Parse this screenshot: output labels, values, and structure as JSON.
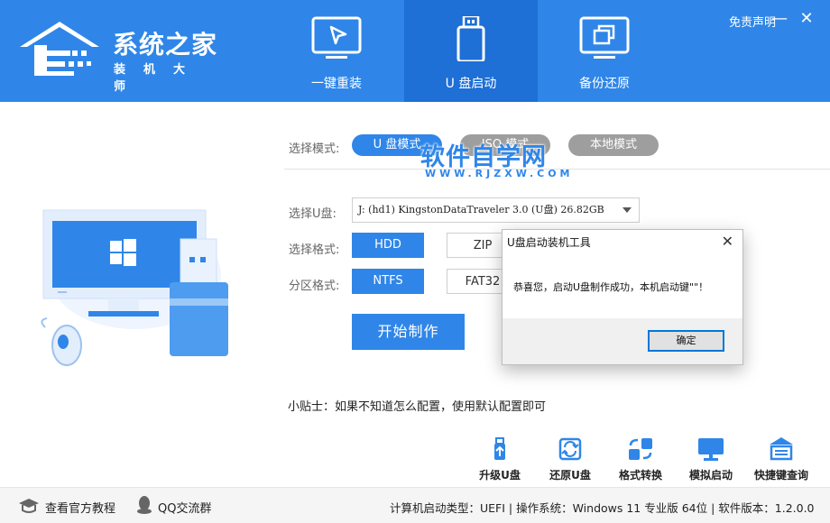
{
  "header": {
    "logo_title": "系统之家",
    "logo_sub": "装机大师",
    "disclaimer": "免责声明",
    "minimize_glyph": "—",
    "close_glyph": "✕",
    "tabs": [
      {
        "label": "一键重装",
        "icon": "cursor-icon"
      },
      {
        "label": "U 盘启动",
        "icon": "usb-drive-icon"
      },
      {
        "label": "备份还原",
        "icon": "backup-icon"
      }
    ]
  },
  "mode": {
    "label": "选择模式:",
    "options": [
      "U 盘模式",
      "ISO 模式",
      "本地模式"
    ]
  },
  "form": {
    "usb_label": "选择U盘:",
    "usb_value": "J: (hd1) KingstonDataTraveler 3.0 (U盘) 26.82GB",
    "format_label": "选择格式:",
    "formats": [
      "HDD",
      "ZIP"
    ],
    "partition_label": "分区格式:",
    "partitions": [
      "NTFS",
      "FAT32"
    ],
    "start_button": "开始制作",
    "tip": "小贴士：如果不知道怎么配置，使用默认配置即可"
  },
  "tools": [
    {
      "label": "升级U盘",
      "icon": "usb-upgrade-icon"
    },
    {
      "label": "还原U盘",
      "icon": "restore-icon"
    },
    {
      "label": "格式转换",
      "icon": "convert-icon"
    },
    {
      "label": "模拟启动",
      "icon": "monitor-icon"
    },
    {
      "label": "快捷键查询",
      "icon": "keyboard-icon"
    }
  ],
  "footer": {
    "tutorial": "查看官方教程",
    "qq_group": "QQ交流群",
    "status": "计算机启动类型：UEFI | 操作系统：Windows 11 专业版 64位 | 软件版本：1.2.0.0"
  },
  "watermark": {
    "title": "软件自学网",
    "url": "WWW.RJZXW.COM"
  },
  "dialog": {
    "title": "U盘启动装机工具",
    "close_glyph": "✕",
    "message": "恭喜您，启动U盘制作成功，本机启动键\"\"！",
    "ok_button": "确定"
  },
  "colors": {
    "brand_blue": "#2f86e8",
    "active_tab": "#1e6fd6",
    "inactive_pill": "#9e9e9e"
  }
}
